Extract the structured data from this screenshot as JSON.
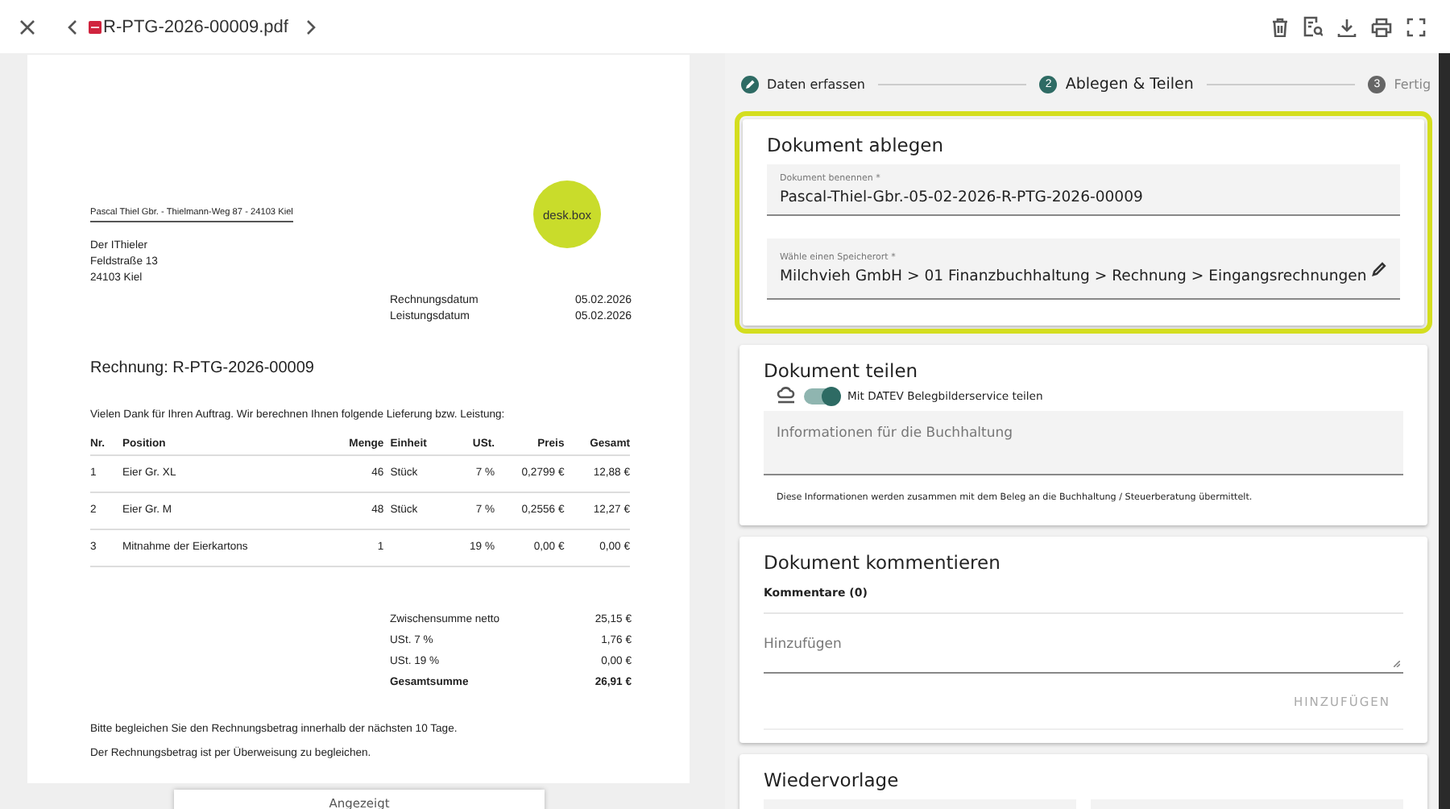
{
  "top_bar": {
    "file_name": "R-PTG-2026-00009.pdf"
  },
  "invoice": {
    "sender_line": "Pascal Thiel Gbr. - Thielmann-Weg 87 - 24103 Kiel",
    "logo_text": "desk.box",
    "recipient": [
      "Der IThieler",
      "Feldstraße   13",
      "24103 Kiel"
    ],
    "dates": [
      {
        "label": "Rechnungsdatum",
        "value": "05.02.2026"
      },
      {
        "label": "Leistungsdatum",
        "value": "05.02.2026"
      }
    ],
    "title": "Rechnung: R-PTG-2026-00009",
    "intro": "Vielen Dank für Ihren Auftrag. Wir berechnen Ihnen folgende Lieferung bzw. Leistung:",
    "columns": [
      "Nr.",
      "Position",
      "Menge",
      "Einheit",
      "USt.",
      "Preis",
      "Gesamt"
    ],
    "rows": [
      {
        "nr": "1",
        "position": "Eier Gr. XL",
        "menge": "46",
        "einheit": "Stück",
        "ust": "7 %",
        "preis": "0,2799 €",
        "gesamt": "12,88 €"
      },
      {
        "nr": "2",
        "position": "Eier Gr. M",
        "menge": "48",
        "einheit": "Stück",
        "ust": "7 %",
        "preis": "0,2556 €",
        "gesamt": "12,27 €"
      },
      {
        "nr": "3",
        "position": "Mitnahme der Eierkartons",
        "menge": "1",
        "ust": "19 %",
        "preis": "0,00 €",
        "gesamt": "0,00 €"
      }
    ],
    "totals": [
      {
        "label": "Zwischensumme netto",
        "value": "25,15 €",
        "bold": false
      },
      {
        "label": "USt. 7 %",
        "value": "1,76 €",
        "bold": false
      },
      {
        "label": "USt. 19 %",
        "value": "0,00 €",
        "bold": false
      },
      {
        "label": "Gesamtsumme",
        "value": "26,91 €",
        "bold": true
      }
    ],
    "footer": [
      "Bitte begleichen Sie den Rechnungsbetrag innerhalb der nächsten 10 Tage.",
      "Der Rechnungsbetrag ist per Überweisung zu begleichen."
    ]
  },
  "viewer_bar": {
    "label": "Angezeigt"
  },
  "stepper": [
    {
      "label": "Daten erfassen",
      "completed": true,
      "selected": false
    },
    {
      "label": "Ablegen & Teilen",
      "completed": false,
      "selected": true,
      "number": "2"
    },
    {
      "label": "Fertig",
      "completed": false,
      "selected": false,
      "number": "3"
    }
  ],
  "store_card": {
    "title": "Dokument ablegen",
    "highlighted": true,
    "fields": [
      {
        "kind": "text",
        "label": "Dokument benennen *",
        "value": "Pascal-Thiel-Gbr.-05-02-2026-R-PTG-2026-00009"
      },
      {
        "kind": "picker",
        "label": "Wähle einen Speicherort *",
        "value": "Milchvieh GmbH > 01 Finanzbuchhaltung > Rechnung > Eingangsrechnungen"
      }
    ]
  },
  "share_card": {
    "title": "Dokument teilen",
    "toggle": {
      "label": "Mit DATEV Belegbilderservice teilen",
      "on": true
    },
    "notes": {
      "placeholder": "Informationen für die Buchhaltung"
    },
    "hint": "Diese Informationen werden zusammen mit dem Beleg an die Buchhaltung / Steuerberatung übermittelt."
  },
  "comment_card": {
    "title": "Dokument kommentieren",
    "count_label": "Kommentare (0)",
    "input": {
      "placeholder": "Hinzufügen"
    },
    "button": {
      "label": "HINZUFÜGEN",
      "disabled": true
    }
  },
  "followup_card": {
    "title": "Wiedervorlage"
  }
}
